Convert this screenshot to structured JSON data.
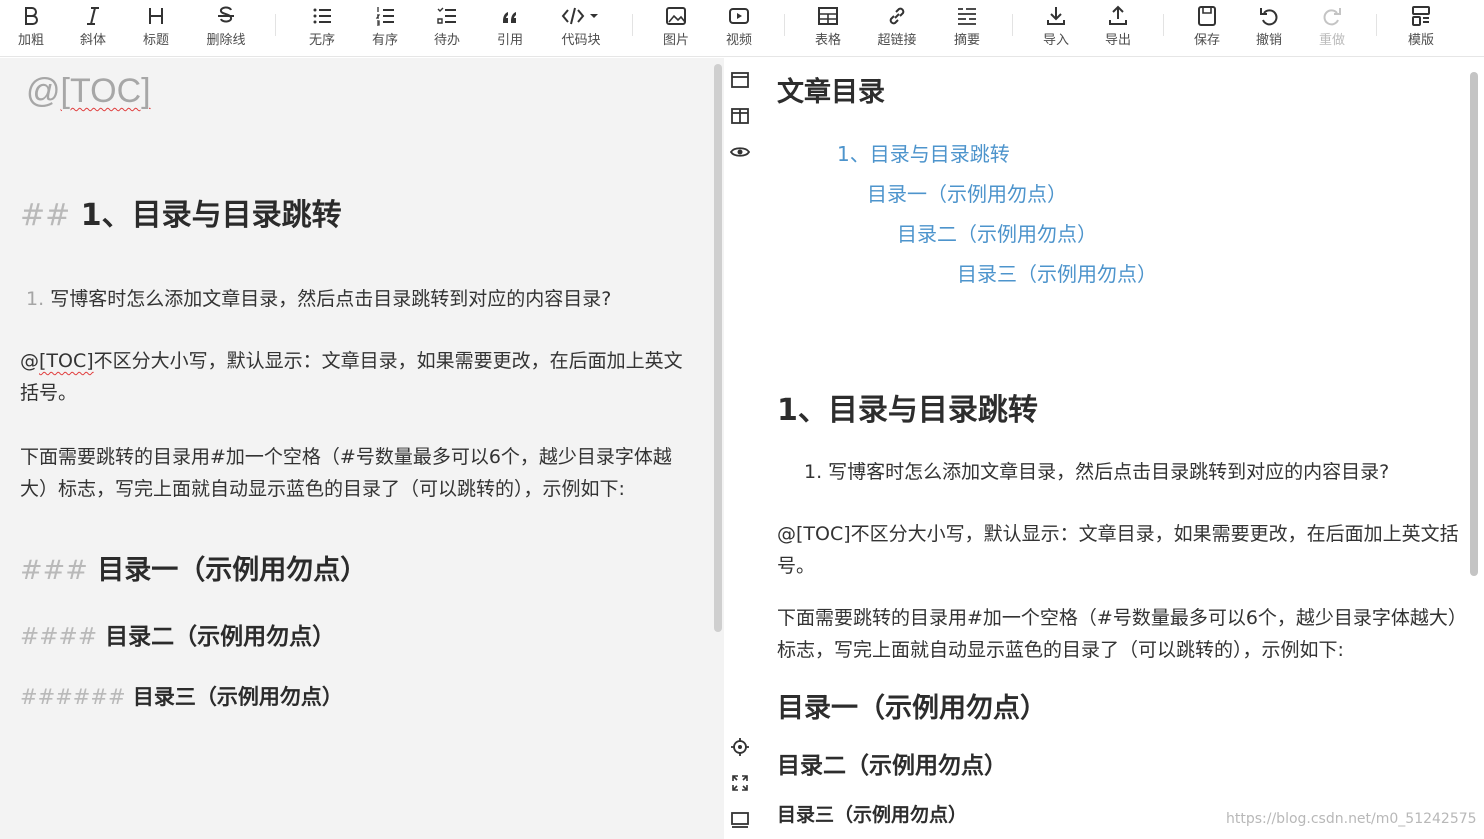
{
  "toolbar": {
    "items": [
      {
        "label": "加粗",
        "icon": "bold-icon"
      },
      {
        "label": "斜体",
        "icon": "italic-icon"
      },
      {
        "label": "标题",
        "icon": "heading-icon"
      },
      {
        "label": "删除线",
        "icon": "strikethrough-icon"
      },
      {
        "label": "无序",
        "icon": "unordered-list-icon"
      },
      {
        "label": "有序",
        "icon": "ordered-list-icon"
      },
      {
        "label": "待办",
        "icon": "todo-list-icon"
      },
      {
        "label": "引用",
        "icon": "quote-icon"
      },
      {
        "label": "代码块",
        "icon": "code-block-icon"
      },
      {
        "label": "图片",
        "icon": "image-icon"
      },
      {
        "label": "视频",
        "icon": "video-icon"
      },
      {
        "label": "表格",
        "icon": "table-icon"
      },
      {
        "label": "超链接",
        "icon": "link-icon"
      },
      {
        "label": "摘要",
        "icon": "summary-icon"
      },
      {
        "label": "导入",
        "icon": "import-icon"
      },
      {
        "label": "导出",
        "icon": "export-icon"
      },
      {
        "label": "保存",
        "icon": "save-icon"
      },
      {
        "label": "撤销",
        "icon": "undo-icon"
      },
      {
        "label": "重做",
        "icon": "redo-icon",
        "disabled": true
      },
      {
        "label": "模版",
        "icon": "template-icon"
      }
    ]
  },
  "editor": {
    "toc_prefix": "@",
    "toc_word": "[TOC]",
    "h2_hash": "##",
    "h2_text": "1、目录与目录跳转",
    "list_num": "1.",
    "list_text": "写博客时怎么添加文章目录，然后点击目录跳转到对应的内容目录?",
    "para1_prefix": "@",
    "para1_code": "[TOC]",
    "para1_text": "不区分大小写，默认显示：文章目录，如果需要更改，在后面加上英文括号。",
    "para2": "下面需要跳转的目录用#加一个空格（#号数量最多可以6个，越少目录字体越大）标志，写完上面就自动显示蓝色的目录了（可以跳转的），示例如下:",
    "h3_hash": "###",
    "h3_text": "目录一（示例用勿点）",
    "h4_hash": "####",
    "h4_text": "目录二（示例用勿点）",
    "h6_hash": "######",
    "h6_text": "目录三（示例用勿点）"
  },
  "preview": {
    "toc_title": "文章目录",
    "toc_links": [
      "1、目录与目录跳转",
      "目录一（示例用勿点）",
      "目录二（示例用勿点）",
      "目录三（示例用勿点）"
    ],
    "h2": "1、目录与目录跳转",
    "list_item": "1. 写博客时怎么添加文章目录，然后点击目录跳转到对应的内容目录?",
    "para1": "@[TOC]不区分大小写，默认显示：文章目录，如果需要更改，在后面加上英文括号。",
    "para2": "下面需要跳转的目录用#加一个空格（#号数量最多可以6个，越少目录字体越大）标志，写完上面就自动显示蓝色的目录了（可以跳转的），示例如下:",
    "h3": "目录一（示例用勿点）",
    "h4": "目录二（示例用勿点）",
    "h6": "目录三（示例用勿点）"
  },
  "side_tools": [
    "edit-only-icon",
    "split-view-icon",
    "preview-eye-icon",
    "locate-icon",
    "fullscreen-icon",
    "toggle-toolbar-icon"
  ],
  "watermark": "https://blog.csdn.net/m0_51242575",
  "colors": {
    "link": "#4d94cc",
    "editor_bg": "#f3f3f3",
    "hash": "#b9b9b9"
  }
}
